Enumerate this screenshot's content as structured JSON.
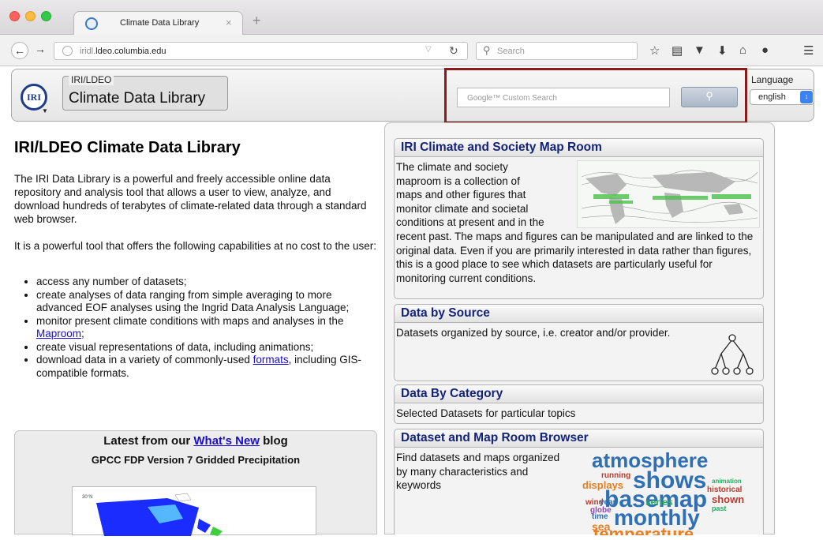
{
  "browser": {
    "tab_title": "Climate Data Library",
    "tab_close": "×",
    "new_tab": "+",
    "url_prefix": "iridl.",
    "url_domain": "ldeo.columbia.edu",
    "search_placeholder": "Search"
  },
  "header": {
    "logo_text": "IRI",
    "breadcrumb_top": "IRI/LDEO",
    "breadcrumb_title": "Climate Data Library",
    "google_placeholder": "Google™ Custom Search",
    "language_label": "Language",
    "language_value": "english"
  },
  "main": {
    "title": "IRI/LDEO Climate Data Library",
    "intro": "The IRI Data Library is a powerful and freely accessible online data repository and analysis tool that allows a user to view, analyze, and download hundreds of terabytes of climate-related data through a standard web browser.",
    "capabilities_intro": "It is a powerful tool that offers the following capabilities at no cost to the user:",
    "cap1": "access any number of datasets;",
    "cap2": "create analyses of data ranging from simple averaging to more advanced EOF analyses using the Ingrid Data Analysis Language;",
    "cap3_prefix": "monitor present climate conditions with maps and analyses in the ",
    "cap3_link": "Maproom",
    "cap3_suffix": ";",
    "cap4": "create visual representations of data, including animations;",
    "cap5_prefix": "download data in a variety of commonly-used ",
    "cap5_link": "formats",
    "cap5_suffix": ", including GIS-compatible formats.",
    "blog_prefix": "Latest from our ",
    "blog_link": "What's New",
    "blog_suffix": " blog",
    "blog_post_title": "GPCC FDP Version 7 Gridded Precipitation",
    "blog_axis_label": "30°N"
  },
  "cards": {
    "maproom": {
      "title": "IRI Climate and Society Map Room",
      "line1": "The climate and society",
      "line2": "maproom is a collection of",
      "line3": "maps and other figures that",
      "line4": "monitor climate and societal",
      "line5": "conditions at present and in the",
      "rest": "recent past. The maps and figures can be manipulated and are linked to the original data. Even if you are primarily interested in data rather than figures, this is a good place to see which datasets are particularly useful for monitoring current conditions."
    },
    "source": {
      "title": "Data by Source",
      "text": "Datasets organized by source, i.e. creator and/or provider."
    },
    "category": {
      "title": "Data By Category",
      "text": "Selected Datasets for particular topics"
    },
    "browser": {
      "title": "Dataset and Map Room Browser",
      "text": "Find datasets and maps organized by many characteristics and keywords",
      "cloud": [
        "atmosphere",
        "shows",
        "displays",
        "running",
        "animation",
        "basemap",
        "historical",
        "wind",
        "year",
        "series",
        "shown",
        "globe",
        "time",
        "past",
        "sea",
        "monthly",
        "temperature"
      ]
    }
  },
  "colors": {
    "highlight_box": "#8b1a1a",
    "card_title": "#14237a",
    "link": "#1a0dcc"
  }
}
